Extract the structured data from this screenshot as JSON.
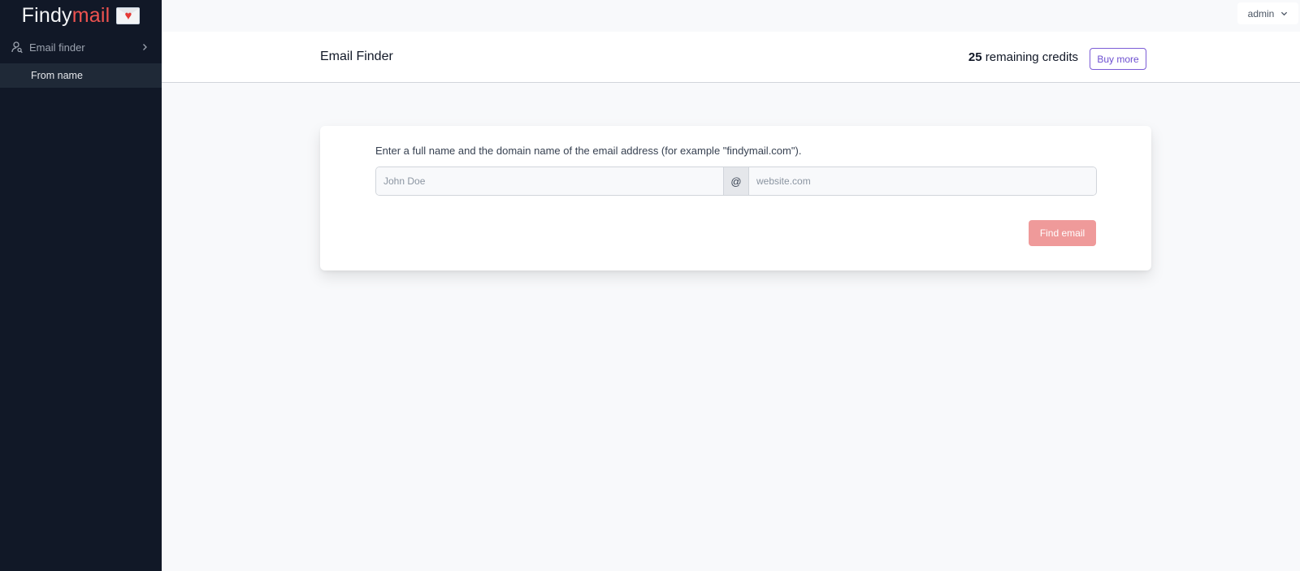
{
  "sidebar": {
    "logo": {
      "part1": "Findy",
      "part2": "mail",
      "icon": "envelope-heart-icon"
    },
    "nav": {
      "group_label": "Email finder",
      "group_icon": "user-search-icon",
      "sub_item": "From name"
    }
  },
  "topbar": {
    "user": "admin"
  },
  "header": {
    "title": "Email Finder",
    "credits_count": "25",
    "credits_label": " remaining credits",
    "buy_label": "Buy more"
  },
  "form": {
    "description": "Enter a full name and the domain name of the email address (for example \"findymail.com\").",
    "name_placeholder": "John Doe",
    "name_value": "",
    "at": "@",
    "domain_placeholder": "website.com",
    "domain_value": "",
    "submit_label": "Find email"
  },
  "colors": {
    "sidebar_bg": "#111827",
    "accent_red": "#ef5350",
    "button_disabled": "#ef9a9a",
    "buy_border": "#7c5cd6"
  }
}
